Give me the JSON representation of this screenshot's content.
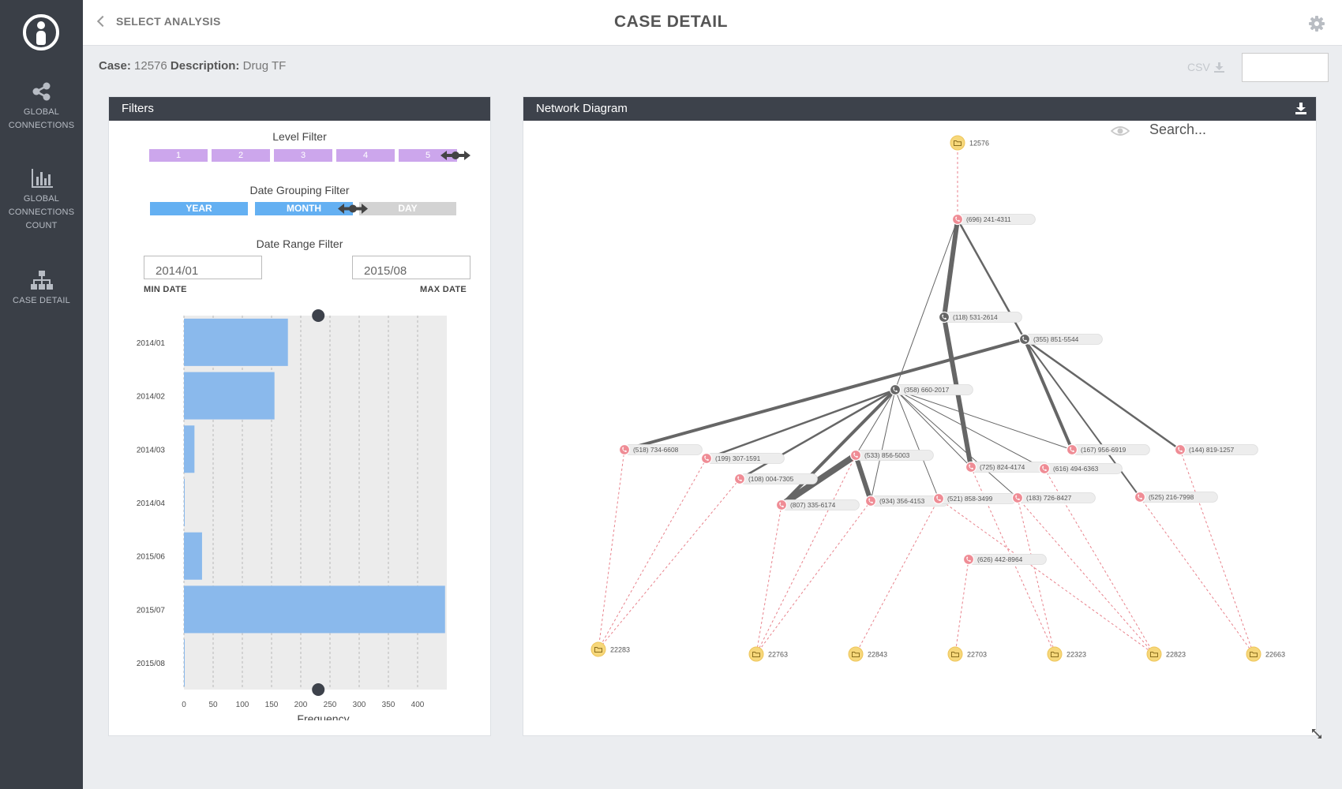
{
  "sidebar": {
    "items": [
      {
        "label_line1": "GLOBAL",
        "label_line2": "CONNECTIONS",
        "label_line3": "",
        "icon": "share-icon"
      },
      {
        "label_line1": "GLOBAL",
        "label_line2": "CONNECTIONS",
        "label_line3": "COUNT",
        "icon": "bar-chart-icon"
      },
      {
        "label_line1": "CASE DETAIL",
        "label_line2": "",
        "label_line3": "",
        "icon": "org-chart-icon"
      }
    ]
  },
  "topbar": {
    "back_label": "SELECT ANALYSIS",
    "title": "CASE DETAIL"
  },
  "case": {
    "case_label": "Case:",
    "case_value": "12576",
    "desc_label": "Description:",
    "desc_value": "Drug TF",
    "csv_label": "CSV"
  },
  "filters": {
    "header": "Filters",
    "level_title": "Level Filter",
    "levels": [
      "1",
      "2",
      "3",
      "4",
      "5"
    ],
    "date_group_title": "Date Grouping Filter",
    "date_groups": [
      "YEAR",
      "MONTH",
      "DAY"
    ],
    "date_range_title": "Date Range Filter",
    "min_date": "2014/01",
    "max_date": "2015/08",
    "min_label": "MIN DATE",
    "max_label": "MAX DATE"
  },
  "chart_data": {
    "type": "bar",
    "orientation": "horizontal",
    "categories": [
      "2014/01",
      "2014/02",
      "2014/03",
      "2014/04",
      "2015/06",
      "2015/07",
      "2015/08"
    ],
    "values": [
      178,
      155,
      18,
      0,
      31,
      447,
      0
    ],
    "xlabel": "Frequency",
    "xticks": [
      0,
      50,
      100,
      150,
      200,
      250,
      300,
      350,
      400
    ],
    "xlim": [
      0,
      450
    ],
    "grid": true,
    "color": "#8ab9ec",
    "slider_value": 230
  },
  "network": {
    "header": "Network Diagram",
    "search_placeholder": "Search...",
    "nodes": [
      {
        "id": "n12576",
        "type": "case",
        "label": "12576"
      },
      {
        "id": "p696",
        "type": "phone-red",
        "label": "(696) 241-4311"
      },
      {
        "id": "p118",
        "type": "phone-dark",
        "label": "(118) 531-2614"
      },
      {
        "id": "p355",
        "type": "phone-dark",
        "label": "(355) 851-5544"
      },
      {
        "id": "p358",
        "type": "phone-dark",
        "label": "(358) 660-2017"
      },
      {
        "id": "p518",
        "type": "phone-red",
        "label": "(518) 734-6608"
      },
      {
        "id": "p199",
        "type": "phone-red",
        "label": "(199) 307-1591"
      },
      {
        "id": "p108",
        "type": "phone-red",
        "label": "(108) 004-7305"
      },
      {
        "id": "p533",
        "type": "phone-red",
        "label": "(533) 856-5003"
      },
      {
        "id": "p807",
        "type": "phone-red",
        "label": "(807) 335-6174"
      },
      {
        "id": "p934",
        "type": "phone-red",
        "label": "(934) 356-4153"
      },
      {
        "id": "p521",
        "type": "phone-red",
        "label": "(521) 858-3499"
      },
      {
        "id": "p725",
        "type": "phone-red",
        "label": "(725) 824-4174"
      },
      {
        "id": "p626",
        "type": "phone-red",
        "label": "(626) 442-8964"
      },
      {
        "id": "p183",
        "type": "phone-red",
        "label": "(183) 726-8427"
      },
      {
        "id": "p616",
        "type": "phone-red",
        "label": "(616) 494-6363"
      },
      {
        "id": "p167",
        "type": "phone-red",
        "label": "(167) 956-6919"
      },
      {
        "id": "p525",
        "type": "phone-red",
        "label": "(525) 216-7998"
      },
      {
        "id": "p144",
        "type": "phone-red",
        "label": "(144) 819-1257"
      },
      {
        "id": "c22283",
        "type": "case",
        "label": "22283"
      },
      {
        "id": "c22763",
        "type": "case",
        "label": "22763"
      },
      {
        "id": "c22843",
        "type": "case",
        "label": "22843"
      },
      {
        "id": "c22703",
        "type": "case",
        "label": "22703"
      },
      {
        "id": "c22323",
        "type": "case",
        "label": "22323"
      },
      {
        "id": "c22823",
        "type": "case",
        "label": "22823"
      },
      {
        "id": "c22663",
        "type": "case",
        "label": "22663"
      }
    ],
    "edges": [
      {
        "from": "n12576",
        "to": "p696",
        "kind": "dashed"
      },
      {
        "from": "p696",
        "to": "p118",
        "kind": "solid",
        "weight": 6
      },
      {
        "from": "p696",
        "to": "p355",
        "kind": "solid",
        "weight": 2.5
      },
      {
        "from": "p696",
        "to": "p358",
        "kind": "solid",
        "weight": 1
      },
      {
        "from": "p118",
        "to": "p725",
        "kind": "solid",
        "weight": 6
      },
      {
        "from": "p355",
        "to": "p518",
        "kind": "solid",
        "weight": 4
      },
      {
        "from": "p355",
        "to": "p167",
        "kind": "solid",
        "weight": 4
      },
      {
        "from": "p355",
        "to": "p144",
        "kind": "solid",
        "weight": 2.5
      },
      {
        "from": "p355",
        "to": "p525",
        "kind": "solid",
        "weight": 2
      },
      {
        "from": "p358",
        "to": "p199",
        "kind": "solid",
        "weight": 2.5
      },
      {
        "from": "p358",
        "to": "p108",
        "kind": "solid",
        "weight": 2.5
      },
      {
        "from": "p358",
        "to": "p533",
        "kind": "solid",
        "weight": 1
      },
      {
        "from": "p358",
        "to": "p807",
        "kind": "solid",
        "weight": 4
      },
      {
        "from": "p358",
        "to": "p934",
        "kind": "solid",
        "weight": 1
      },
      {
        "from": "p358",
        "to": "p521",
        "kind": "solid",
        "weight": 1
      },
      {
        "from": "p358",
        "to": "p725",
        "kind": "solid",
        "weight": 1
      },
      {
        "from": "p358",
        "to": "p183",
        "kind": "solid",
        "weight": 1
      },
      {
        "from": "p358",
        "to": "p616",
        "kind": "solid",
        "weight": 1
      },
      {
        "from": "p358",
        "to": "p167",
        "kind": "solid",
        "weight": 1
      },
      {
        "from": "p533",
        "to": "p807",
        "kind": "solid",
        "weight": 8
      },
      {
        "from": "p533",
        "to": "p934",
        "kind": "solid",
        "weight": 6
      },
      {
        "from": "p518",
        "to": "c22283",
        "kind": "dashed"
      },
      {
        "from": "p199",
        "to": "c22283",
        "kind": "dashed"
      },
      {
        "from": "p108",
        "to": "c22283",
        "kind": "dashed"
      },
      {
        "from": "p807",
        "to": "c22763",
        "kind": "dashed"
      },
      {
        "from": "p533",
        "to": "c22763",
        "kind": "dashed"
      },
      {
        "from": "p934",
        "to": "c22763",
        "kind": "dashed"
      },
      {
        "from": "p521",
        "to": "c22843",
        "kind": "dashed"
      },
      {
        "from": "p626",
        "to": "c22703",
        "kind": "dashed"
      },
      {
        "from": "p725",
        "to": "c22323",
        "kind": "dashed"
      },
      {
        "from": "p183",
        "to": "c22323",
        "kind": "dashed"
      },
      {
        "from": "p521",
        "to": "c22823",
        "kind": "dashed"
      },
      {
        "from": "p616",
        "to": "c22823",
        "kind": "dashed"
      },
      {
        "from": "p183",
        "to": "c22823",
        "kind": "dashed"
      },
      {
        "from": "p525",
        "to": "c22663",
        "kind": "dashed"
      },
      {
        "from": "p144",
        "to": "c22663",
        "kind": "dashed"
      }
    ]
  },
  "colors": {
    "sidebar": "#3a3f47",
    "panel_header": "#3d424b",
    "level_segment": "#cca6ec",
    "date_group_active": "#64b0f2",
    "date_group_inactive": "#d3d3d3",
    "bar": "#8ab9ec",
    "case_node": "#f6d77a",
    "phone_node_red": "#ef8c95",
    "phone_node_dark": "#666666",
    "dashed_edge": "#e8828c"
  }
}
